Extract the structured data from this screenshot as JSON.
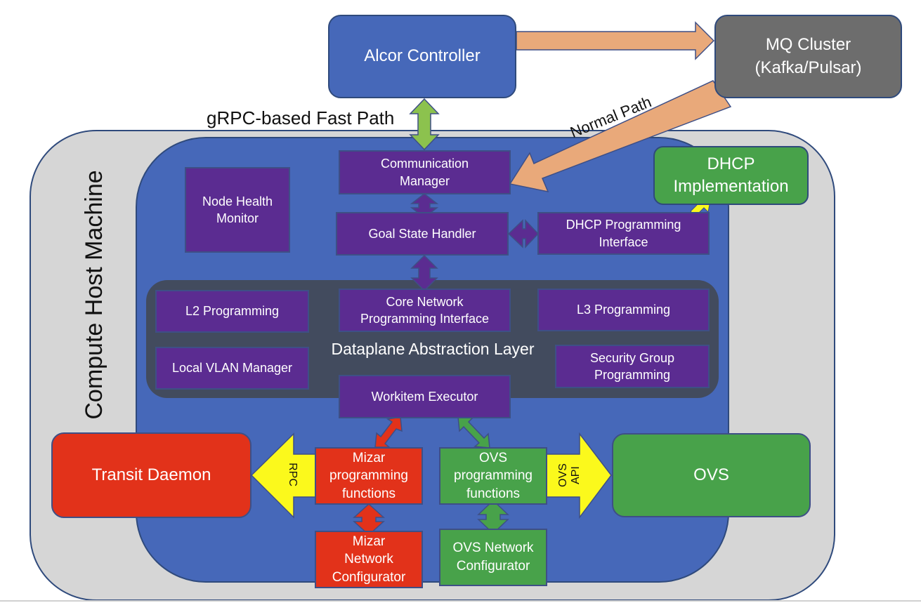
{
  "diagram": {
    "controller": "Alcor Controller",
    "mq_cluster": "MQ Cluster\n(Kafka/Pulsar)",
    "fast_path_label": "gRPC-based Fast Path",
    "normal_path_label": "Normal Path",
    "host_label": "Compute Host Machine",
    "dhcp_impl": "DHCP\nImplementation",
    "node_health": "Node Health\nMonitor",
    "comm_manager": "Communication\nManager",
    "goal_state": "Goal State Handler",
    "dhcp_interface": "DHCP Programming\nInterface",
    "dal_label": "Dataplane Abstraction Layer",
    "l2": "L2 Programming",
    "core_net": "Core Network\nProgramming Interface",
    "l3": "L3 Programming",
    "local_vlan": "Local VLAN Manager",
    "security_group": "Security Group\nProgramming",
    "workitem": "Workitem Executor",
    "transit": "Transit Daemon",
    "rpc_label": "RPC",
    "mizar_prog": "Mizar\nprogramming\nfunctions",
    "mizar_net": "Mizar\nNetwork\nConfigurator",
    "ovs_prog": "OVS\nprogramming\nfunctions",
    "ovs_net": "OVS Network\nConfigurator",
    "ovs_api_label": "OVS\nAPI",
    "ovs": "OVS"
  },
  "colors": {
    "controller": "#4668b9",
    "mq": "#6d6d6d",
    "purple": "#5b2c91",
    "red": "#e2321a",
    "green": "#48a24a",
    "yellow": "#fbf91c",
    "peach": "#e9a97a",
    "lime": "#8cc24e"
  }
}
